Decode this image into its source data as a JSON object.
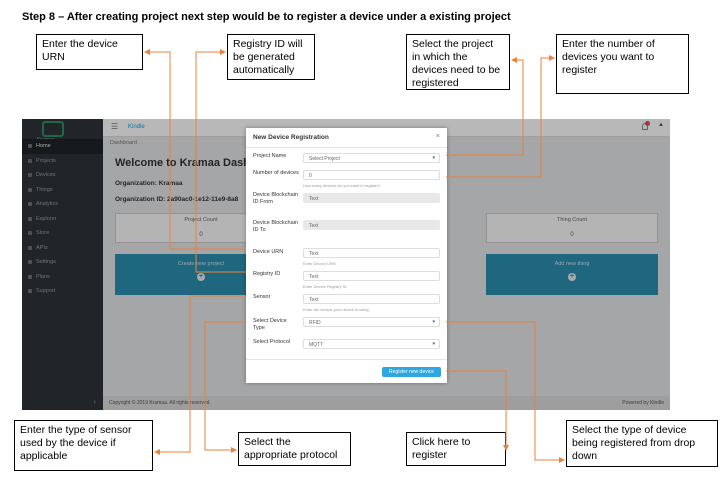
{
  "heading": "Step 8 – After creating project next step would be to register a device under a existing project",
  "callouts": {
    "urn": "Enter the device URN",
    "registry": "Registry ID will be generated automatically",
    "project": "Select the project in which the devices need to be registered",
    "number": "Enter the number of devices you want to register",
    "sensor": "Enter the type of sensor used by the device if applicable",
    "protocol": "Select the appropriate protocol",
    "click": "Click here to register",
    "type": "Select the type of device being registered from drop down"
  },
  "app": {
    "logo_text": "Kramaa",
    "brand": "Kindle",
    "notification_count": "2",
    "breadcrumb": "Dashboard",
    "sidebar": [
      "Home",
      "Projects",
      "Devices",
      "Things",
      "Analytics",
      "Explorer",
      "Store",
      "APIs",
      "Settings",
      "Plans",
      "Support"
    ],
    "welcome": "Welcome to Kramaa Dash",
    "organization": "Organization: Kramaa",
    "organization_id": "Organization ID: 2a90ac0-1e12-11e9-8a8",
    "cards": {
      "project_count": "Project Count",
      "project_value": "0",
      "thing_count": "Thing Count",
      "thing_value": "0"
    },
    "tiles": {
      "create_project": "Create new project",
      "add_thing": "Add new thing"
    },
    "footer_left": "Copyright © 2019 Kramaa. All rights reserved.",
    "footer_right": "Powered by Kindle"
  },
  "modal": {
    "title": "New Device Registration",
    "close": "×",
    "project_label": "Project Name",
    "project_value": "Select Project",
    "number_label": "Number of devices",
    "number_value": "0",
    "number_help": "How many devices do you want to register?",
    "from_label": "Device Blockchain ID From",
    "from_value": "Text",
    "to_label": "Device Blockchain ID To",
    "to_value": "Text",
    "urn_label": "Device URN",
    "urn_value": "Text",
    "urn_help": "Enter Device URN",
    "registry_label": "Registry ID",
    "registry_value": "Text",
    "registry_help": "Enter Device Registry ID",
    "sensor_label": "Sensor",
    "sensor_value": "Text",
    "sensor_help": "Enter the sensor your device is using",
    "type_label": "Select Device Type",
    "type_value": "RFID",
    "protocol_label": "Select Protocol",
    "protocol_value": "MQTT",
    "submit": "Register new device"
  },
  "colors": {
    "arrow": "#e8833a",
    "sidebar": "#2f343a",
    "tile": "#2c8fb0",
    "button": "#2ea6e0"
  }
}
